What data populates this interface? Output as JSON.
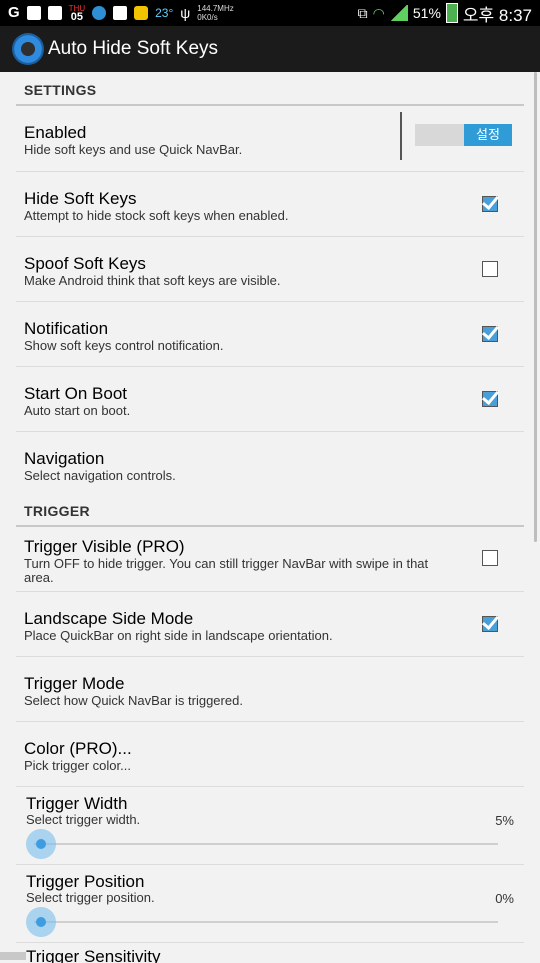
{
  "status_bar": {
    "date_day": "THU",
    "date_num": "05",
    "temperature": "23°",
    "speed": "144.7MHz",
    "speed2": "0K0/s",
    "battery": "51%",
    "time": "오후 8:37"
  },
  "app": {
    "title": "Auto Hide Soft Keys"
  },
  "sections": {
    "settings": "SETTINGS",
    "trigger": "TRIGGER"
  },
  "items": {
    "enabled": {
      "title": "Enabled",
      "summary": "Hide soft keys and use Quick NavBar.",
      "toggle_label": "설정"
    },
    "hide_soft_keys": {
      "title": "Hide Soft Keys",
      "summary": "Attempt to hide stock soft keys when enabled.",
      "checked": true
    },
    "spoof_soft_keys": {
      "title": "Spoof Soft Keys",
      "summary": "Make Android think that soft keys are visible.",
      "checked": false
    },
    "notification": {
      "title": "Notification",
      "summary": "Show soft keys control notification.",
      "checked": true
    },
    "start_on_boot": {
      "title": "Start On Boot",
      "summary": "Auto start on boot.",
      "checked": true
    },
    "navigation": {
      "title": "Navigation",
      "summary": "Select navigation controls."
    },
    "trigger_visible": {
      "title": "Trigger Visible (PRO)",
      "summary": "Turn OFF to hide trigger. You can still trigger NavBar with swipe in that area.",
      "checked": false
    },
    "landscape_side_mode": {
      "title": "Landscape Side Mode",
      "summary": "Place QuickBar on right side in landscape orientation.",
      "checked": true
    },
    "trigger_mode": {
      "title": "Trigger Mode",
      "summary": "Select how Quick NavBar is triggered."
    },
    "color": {
      "title": "Color (PRO)...",
      "summary": "Pick trigger color..."
    },
    "trigger_width": {
      "title": "Trigger Width",
      "summary": "Select trigger width.",
      "value": "5%"
    },
    "trigger_position": {
      "title": "Trigger Position",
      "summary": "Select trigger position.",
      "value": "0%"
    },
    "trigger_sensitivity": {
      "title": "Trigger Sensitivity"
    }
  }
}
